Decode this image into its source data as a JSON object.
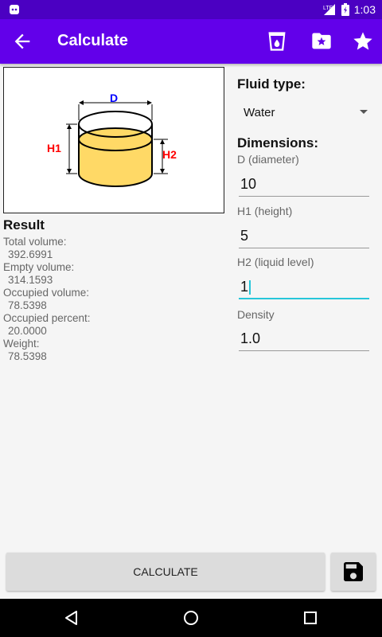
{
  "status_bar": {
    "time": "1:03",
    "network": "LTE",
    "icons": [
      "android-icon",
      "signal-icon",
      "battery-icon"
    ]
  },
  "app_bar": {
    "title": "Calculate",
    "icons": [
      "arrow-back-icon",
      "liquid-glass-icon",
      "folder-star-icon",
      "star-icon"
    ]
  },
  "diagram": {
    "label_d": "D",
    "label_h1": "H1",
    "label_h2": "H2",
    "colors": {
      "d_label": "#0000ff",
      "h_labels": "#ff0000",
      "liquid": "#ffd966"
    }
  },
  "result": {
    "title": "Result",
    "items": [
      {
        "label": "Total volume:",
        "value": "392.6991"
      },
      {
        "label": "Empty volume:",
        "value": "314.1593"
      },
      {
        "label": "Occupied volume:",
        "value": "78.5398"
      },
      {
        "label": "Occupied percent:",
        "value": "20.0000"
      },
      {
        "label": "Weight:",
        "value": "78.5398"
      }
    ]
  },
  "form": {
    "fluid_type_label": "Fluid type:",
    "fluid_type_value": "Water",
    "dimensions_label": "Dimensions:",
    "fields": [
      {
        "label": "D (diameter)",
        "value": "10"
      },
      {
        "label": "H1 (height)",
        "value": "5"
      },
      {
        "label": "H2 (liquid level)",
        "value": "1"
      },
      {
        "label": "Density",
        "value": "1.0"
      }
    ]
  },
  "buttons": {
    "calculate": "CALCULATE",
    "save_icon": "save-icon"
  },
  "nav_bar": {
    "icons": [
      "nav-back-icon",
      "nav-home-icon",
      "nav-recents-icon"
    ]
  },
  "theme": {
    "primary": "#6200ea",
    "status_bar": "#4b00c2",
    "accent": "#26c6da"
  }
}
